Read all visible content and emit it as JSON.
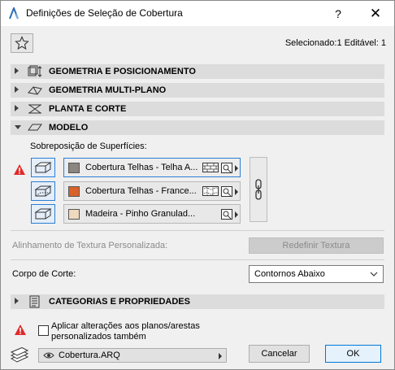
{
  "window": {
    "title": "Definições de Seleção de Cobertura",
    "help_label": "?",
    "close_label": "✕"
  },
  "header": {
    "selection_info": "Selecionado:1 Editável: 1"
  },
  "sections": {
    "geometry": "GEOMETRIA E POSICIONAMENTO",
    "multiplane": "GEOMETRIA MULTI-PLANO",
    "plan": "PLANTA E CORTE",
    "model": "MODELO",
    "categories": "CATEGORIAS E PROPRIEDADES"
  },
  "model": {
    "overrides_label": "Sobreposição de Superfícies:",
    "surfaces": [
      {
        "name": "Cobertura Telhas - Telha A...",
        "color": "#8c8580"
      },
      {
        "name": "Cobertura Telhas - France...",
        "color": "#d9622b"
      },
      {
        "name": "Madeira - Pinho Granulad...",
        "color": "#efd9bf"
      }
    ],
    "texture_alignment_label": "Alinhamento de Textura Personalizada:",
    "reset_texture_label": "Redefinir Textura",
    "cut_body_label": "Corpo de Corte:",
    "cut_body_value": "Contornos Abaixo"
  },
  "footer": {
    "apply_label_line1": "Aplicar alterações aos planos/arestas",
    "apply_label_line2": "personalizados também",
    "favorite_value": "Cobertura.ARQ",
    "cancel_label": "Cancelar",
    "ok_label": "OK"
  },
  "colors": {
    "accent": "#2a7fd4",
    "warning": "#e02a2a",
    "section_bg": "#dcdcdc"
  }
}
